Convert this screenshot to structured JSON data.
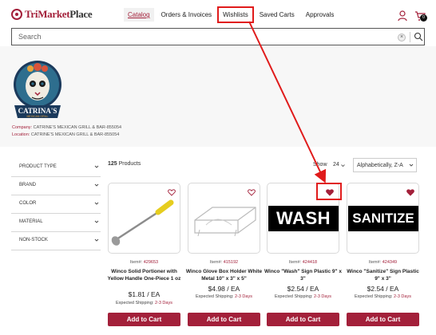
{
  "brand": {
    "name_part1": "TriMarket",
    "name_part2": "Place",
    "accent_color": "#a3203a"
  },
  "nav": {
    "items": [
      {
        "label": "Catalog",
        "state": "active"
      },
      {
        "label": "Orders & Invoices",
        "state": "normal"
      },
      {
        "label": "Wishlists",
        "state": "highlighted"
      },
      {
        "label": "Saved Carts",
        "state": "normal"
      },
      {
        "label": "Approvals",
        "state": "normal"
      }
    ]
  },
  "header_icons": {
    "user": "user-icon",
    "cart": "cart-icon",
    "cart_count": "0"
  },
  "search": {
    "placeholder": "Search",
    "clear_icon": "clear-icon",
    "submit_icon": "search-icon"
  },
  "company": {
    "logo_text": "CATRINA'S",
    "logo_subtext": "MEXICAN GRILL",
    "company_label": "Company:",
    "company_value": "CATRINE'S MEXICAN GRILL & BAR-855054",
    "location_label": "Location:",
    "location_value": "CATRINE'S MEXICAN GRILL & BAR-855054"
  },
  "filters": [
    {
      "label": "PRODUCT TYPE"
    },
    {
      "label": "BRAND"
    },
    {
      "label": "COLOR"
    },
    {
      "label": "MATERIAL"
    },
    {
      "label": "NON-STOCK"
    }
  ],
  "results": {
    "count": "125",
    "count_label": "Products",
    "show_label": "Show",
    "show_value": "24",
    "sort_value": "Alphabetically, Z-A"
  },
  "products": [
    {
      "item_label": "Item#:",
      "item_number": "429653",
      "name": "Winco Solid Portioner with Yellow Handle One-Piece 1 oz",
      "price": "$1.81 / EA",
      "ship_label": "Expected Shipping:",
      "ship_days": "2-3 Days",
      "button": "Add to Cart",
      "wishlisted": false
    },
    {
      "item_label": "Item#:",
      "item_number": "415192",
      "name": "Winco Glove Box Holder White Metal 10\" x 3\" x 5\"",
      "price": "$4.98 / EA",
      "ship_label": "Expected Shipping:",
      "ship_days": "2-3 Days",
      "button": "Add to Cart",
      "wishlisted": false
    },
    {
      "item_label": "Item#:",
      "item_number": "424418",
      "name": "Winco \"Wash\" Sign Plastic 9\" x 3\"",
      "price": "$2.54 / EA",
      "ship_label": "Expected Shipping:",
      "ship_days": "2-3 Days",
      "button": "Add to Cart",
      "wishlisted": true,
      "sign_text": "WASH"
    },
    {
      "item_label": "Item#:",
      "item_number": "424349",
      "name": "Winco \"Sanitize\" Sign Plastic 9\" x 3\"",
      "price": "$2.54 / EA",
      "ship_label": "Expected Shipping:",
      "ship_days": "2-3 Days",
      "button": "Add to Cart",
      "wishlisted": true,
      "sign_text": "SANITIZE"
    }
  ],
  "annotations": {
    "highlight_color": "#e01b1b"
  }
}
